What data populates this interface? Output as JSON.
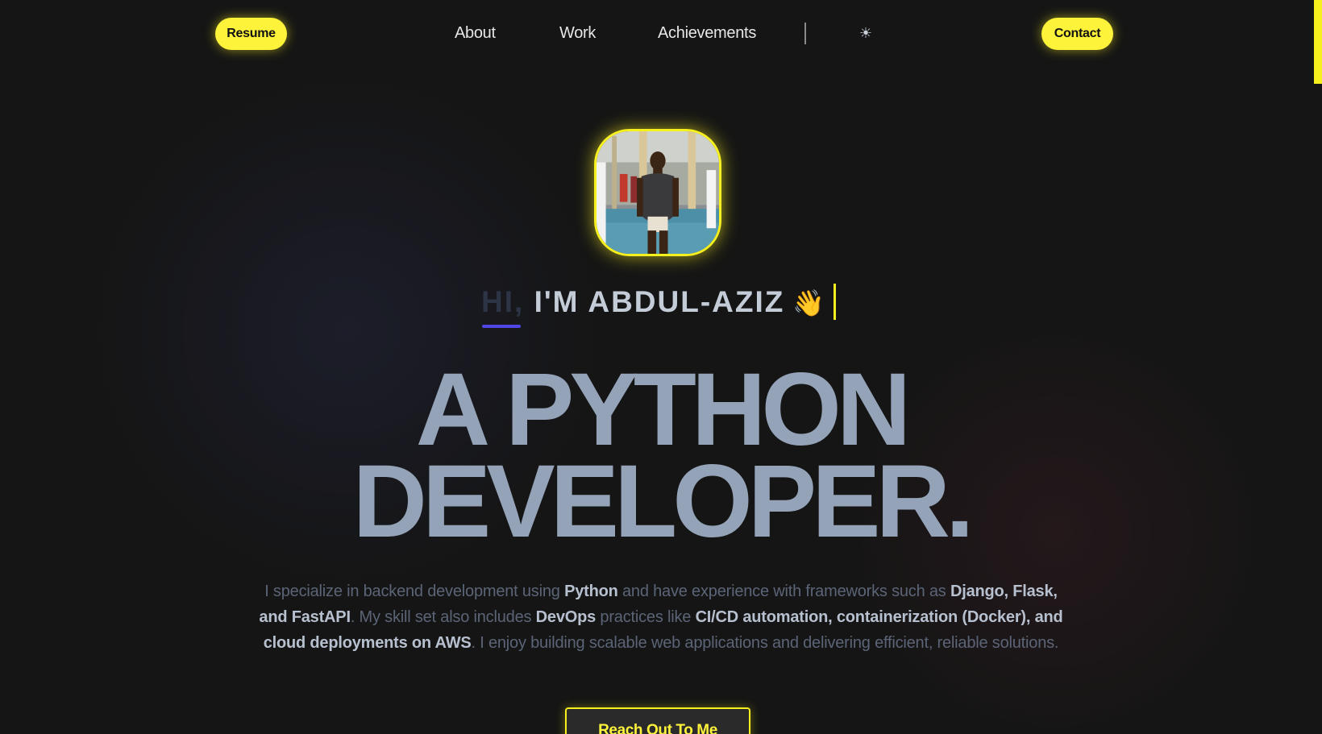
{
  "nav": {
    "resume_label": "Resume",
    "links": [
      "About",
      "Work",
      "Achievements"
    ],
    "theme_icon": "sun-icon",
    "theme_glyph": "☀",
    "contact_label": "Contact"
  },
  "hero": {
    "greeting_hi": "HI,",
    "greeting_rest": "I'M ABDUL-AZIZ",
    "greeting_emoji": "👋",
    "headline_line1": "A PYTHON",
    "headline_line2": "DEVELOPER.",
    "description": [
      {
        "text": "I specialize in backend development using ",
        "bold": false
      },
      {
        "text": "Python",
        "bold": true
      },
      {
        "text": " and have experience with frameworks such as ",
        "bold": false
      },
      {
        "text": "Django, Flask, and FastAPI",
        "bold": true
      },
      {
        "text": ". My skill set also includes ",
        "bold": false
      },
      {
        "text": "DevOps",
        "bold": true
      },
      {
        "text": " practices like ",
        "bold": false
      },
      {
        "text": "CI/CD automation, containerization (Docker), and cloud deployments on AWS",
        "bold": true
      },
      {
        "text": ". I enjoy building scalable web applications and delivering efficient, reliable solutions.",
        "bold": false
      }
    ],
    "cta_label": "Reach Out To Me"
  },
  "colors": {
    "background": "#151515",
    "accent_yellow": "#f7f01f",
    "text_slate": "#94a3b8",
    "underline_indigo": "#4f46e5"
  }
}
